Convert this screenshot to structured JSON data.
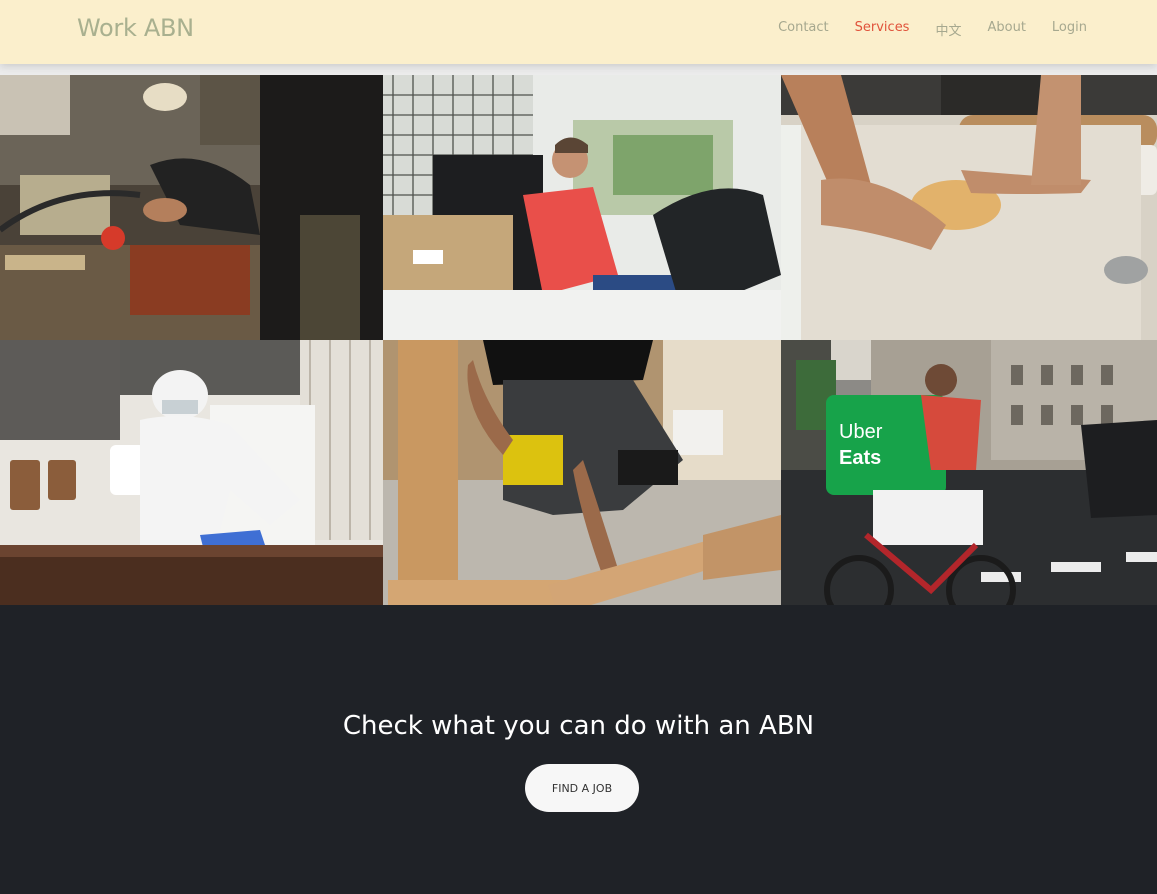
{
  "brand": "Work ABN",
  "nav": {
    "contact": "Contact",
    "services": "Services",
    "chinese": "中文",
    "about": "About",
    "login": "Login"
  },
  "gallery": {
    "images": [
      "metalworker-spraying-vise-photo",
      "courier-in-van-photo",
      "baker-kneading-dough-photo",
      "cleaner-in-protective-suit-photo",
      "carpenter-drilling-wood-photo",
      "food-delivery-cyclist-photo"
    ],
    "bag_text_line1": "Uber",
    "bag_text_line2": "Eats"
  },
  "cta": {
    "title": "Check what you can do with an ABN",
    "button": "FIND A JOB"
  },
  "colors": {
    "navbar_bg": "#fbefcc",
    "brand": "#a9b08f",
    "nav_link": "#a6a88f",
    "nav_active": "#e0533b",
    "cta_bg": "#1f2227",
    "bag_green": "#17a34a"
  }
}
